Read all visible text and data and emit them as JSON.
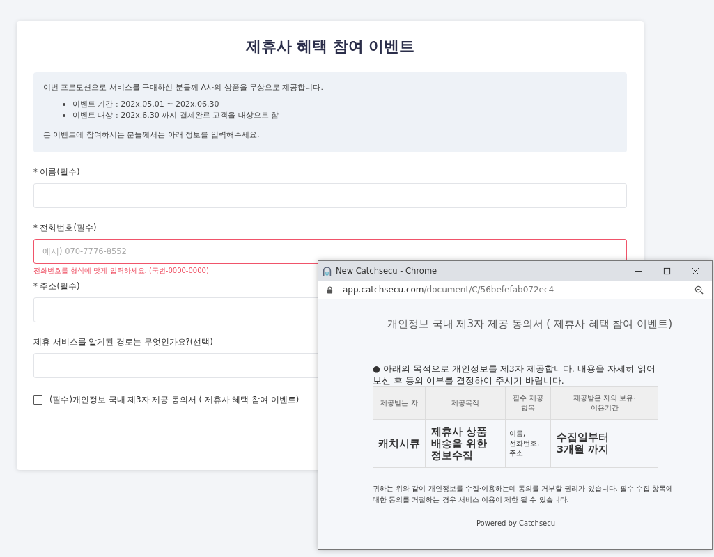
{
  "form": {
    "title": "제휴사 혜택 참여 이벤트",
    "intro": {
      "text": "이번 프로모션으로 서비스를 구매하신 분들께 A사의 상품을 무상으로 제공합니다.",
      "bullets": [
        "이벤트 기간 : 202x.05.01 ~ 202x.06.30",
        "이벤트 대상 : 202x.6.30 까지 결제완료 고객을 대상으로 함"
      ],
      "note": "본 이벤트에 참여하시는 분들께서는 아래 정보를 입력해주세요."
    },
    "fields": [
      {
        "label": "* 이름(필수)",
        "invalid": false
      },
      {
        "label": "* 전화번호(필수)",
        "placeholder": "예시) 070-7776-8552",
        "invalid": true,
        "error": "전화번호를 형식에 맞게 입력하세요. (국번-0000-0000)"
      },
      {
        "label": "* 주소(필수)",
        "invalid": false
      },
      {
        "label": "제휴 서비스를 알게된 경로는 무엇인가요?(선택)",
        "invalid": false
      }
    ],
    "consent": {
      "checked": false,
      "label": "(필수)개인정보 국내 제3자 제공 동의서 ( 제휴사 혜택 참여 이벤트)"
    }
  },
  "popup": {
    "window_title": "New Catchsecu - Chrome",
    "url_host": "app.catchsecu.com",
    "url_path": "/document/C/56befefab072ec4",
    "doc_title": "개인정보 국내 제3자 제공 동의서 ( 제휴사 혜택 참여 이벤트)",
    "intro": "● 아래의 목적으로 개인정보를 제3자 제공합니다. 내용을 자세히 읽어 보신 후 동의 여부를 결정하여 주시기 바랍니다.",
    "table": {
      "columns": [
        "제공받는 자",
        "제공목적",
        "필수 제공\n항목",
        "제공받은 자의 보유·\n이용기간"
      ],
      "rows": [
        [
          "캐치시큐",
          "제휴사 상품\n배송을 위한\n정보수집",
          "이름,\n전화번호,\n주소",
          "수집일부터\n3개월 까지"
        ]
      ]
    },
    "notice": "귀하는 위와 같이 개인정보를 수집·이용하는데 동의를 거부할 권리가 있습니다. 필수 수집 항목에 대한 동의를 거절하는 경우 서비스 이용이 제한 될 수 있습니다.",
    "footer": "Powered by Catchsecu"
  }
}
